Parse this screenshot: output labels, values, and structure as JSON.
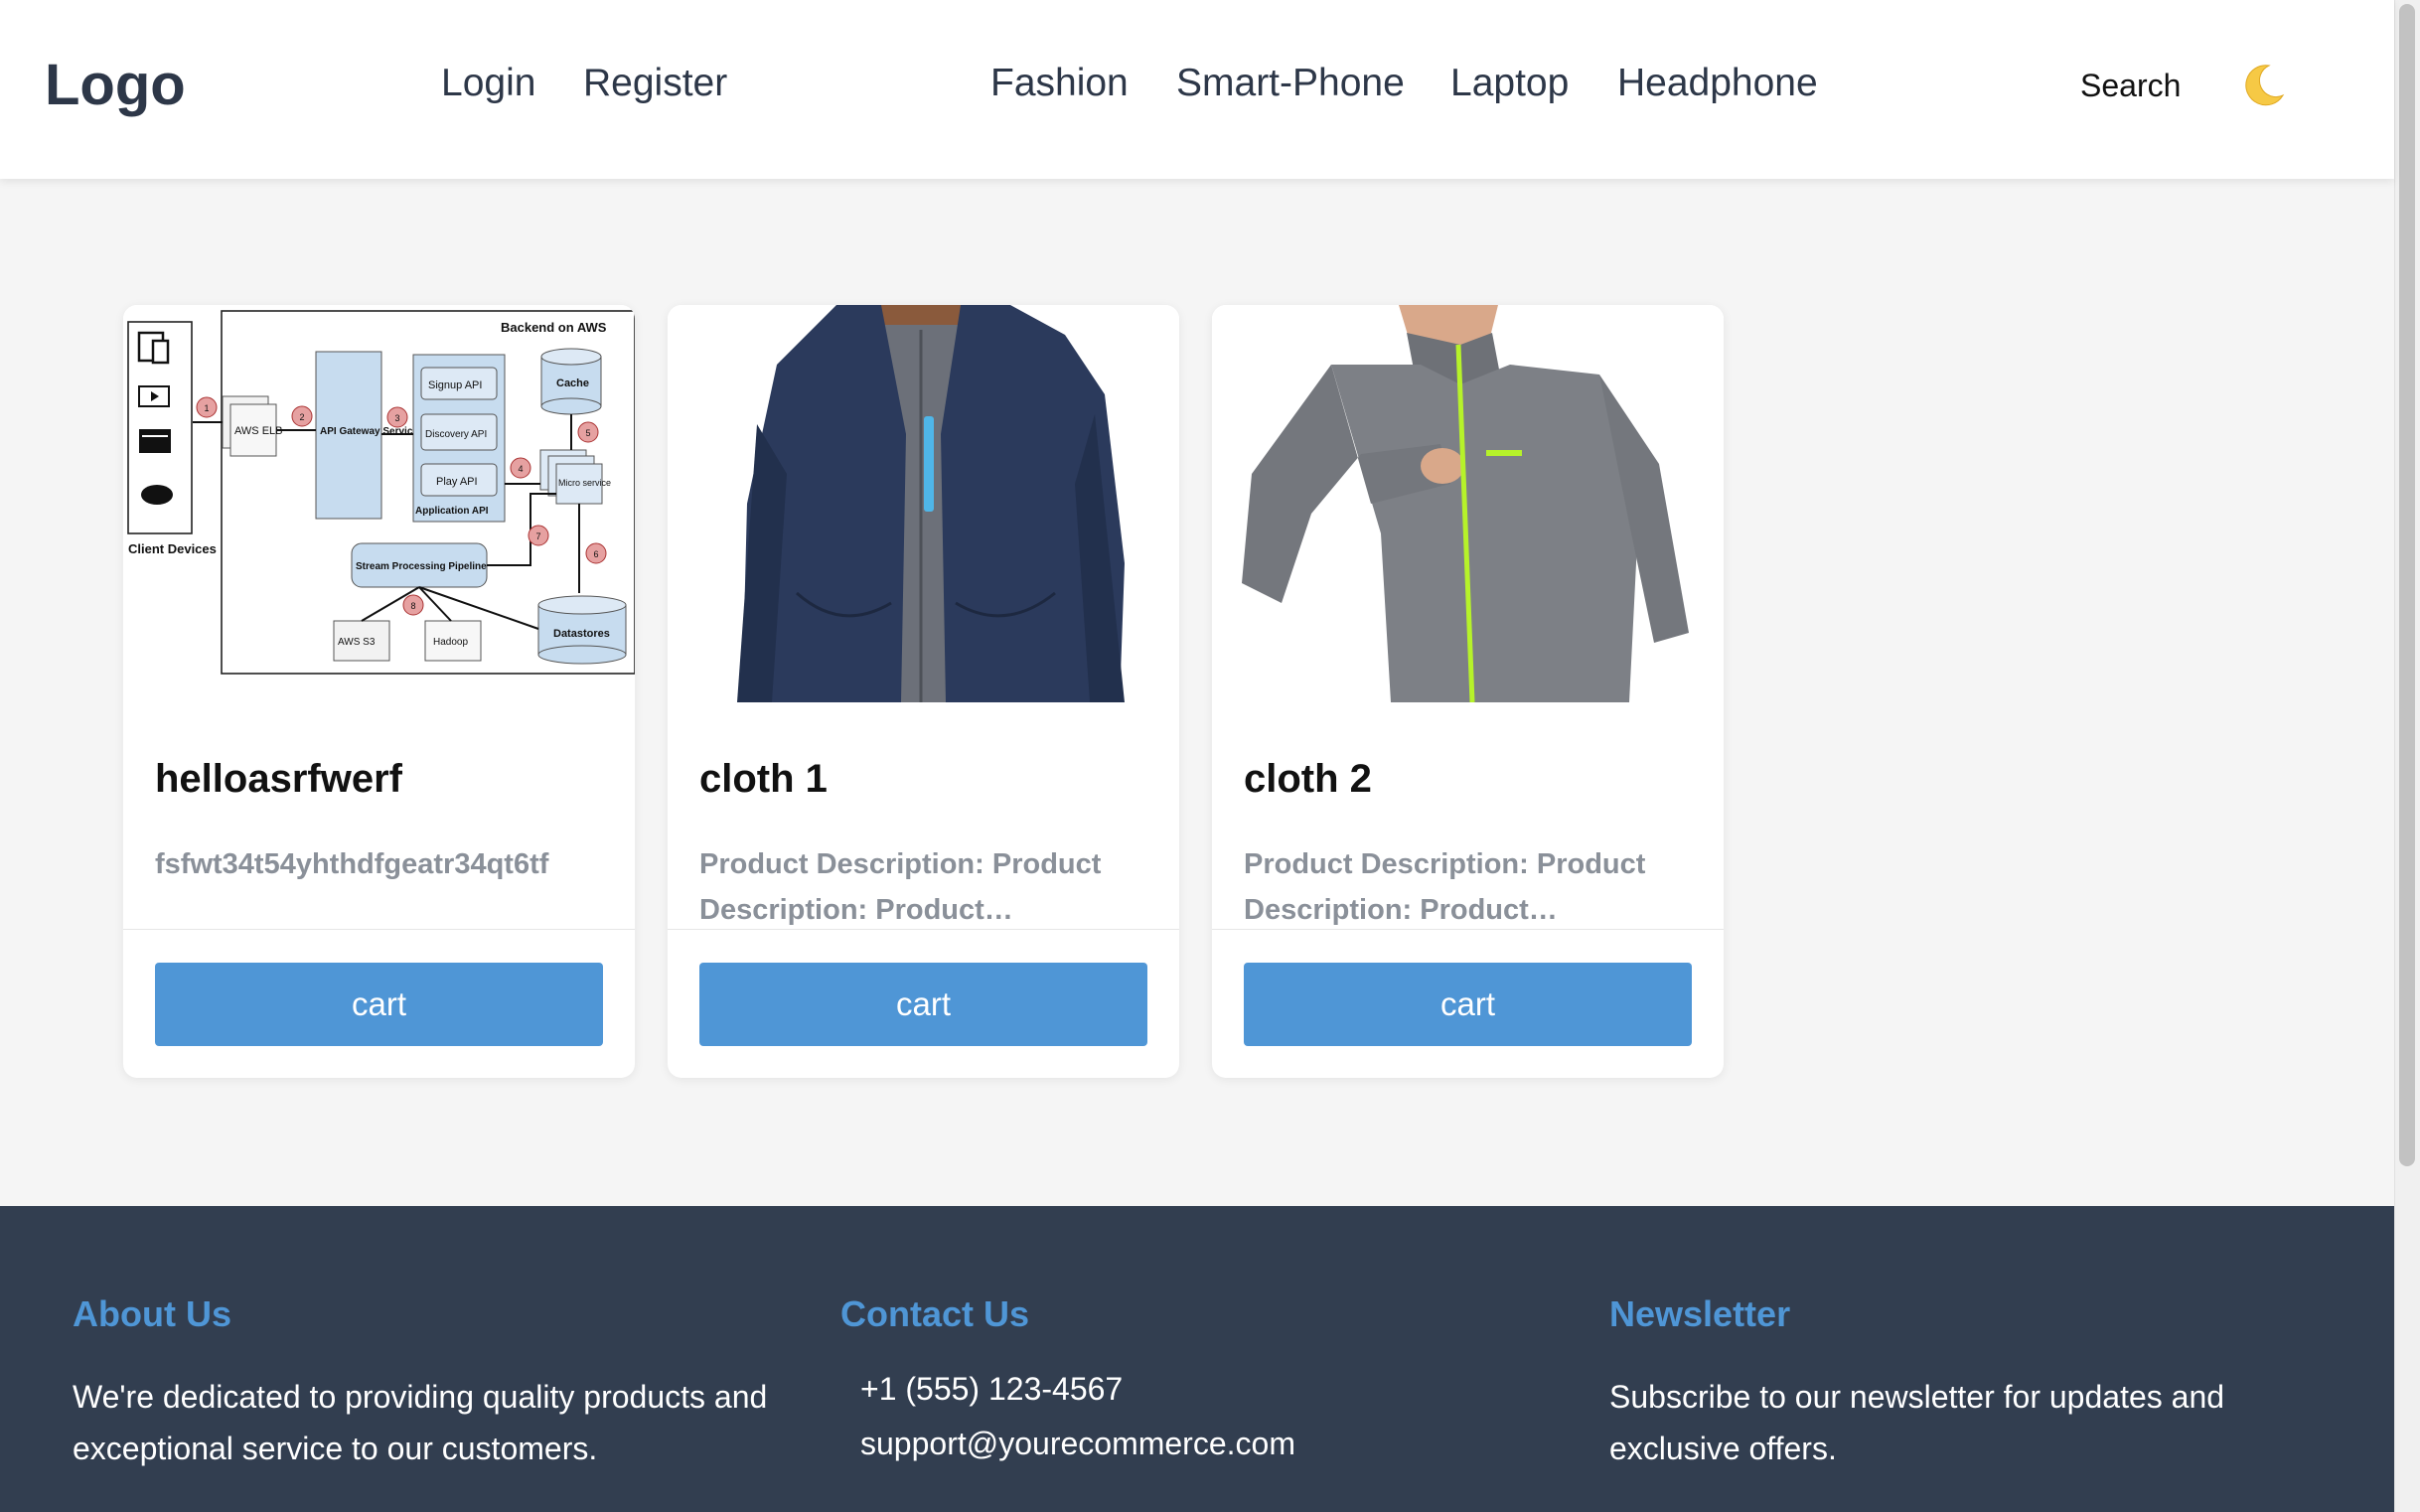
{
  "header": {
    "logo": "Logo",
    "auth_links": [
      "Login",
      "Register"
    ],
    "categories": [
      "Fashion",
      "Smart-Phone",
      "Laptop",
      "Headphone"
    ],
    "search_label": "Search",
    "theme_toggle_icon": "moon-icon"
  },
  "products": [
    {
      "title": "helloasrfwerf",
      "description": "fsfwt34t54yhthdfgeatr34qt6tf",
      "cart_label": "cart",
      "image": {
        "heading": "Backend on AWS",
        "client_label": "Client Devices",
        "aws_elb": "AWS ELB",
        "api_gateway": "API Gateway Service",
        "signup_api": "Signup API",
        "discovery_api": "Discovery API",
        "play_api": "Play API",
        "application_api": "Application API",
        "cache": "Cache",
        "micro_service": "Micro service",
        "stream_pipeline": "Stream Processing Pipeline",
        "aws_s3": "AWS S3",
        "hadoop": "Hadoop",
        "datastores": "Datastores",
        "step_numbers": [
          "1",
          "2",
          "3",
          "4",
          "5",
          "6",
          "7",
          "8"
        ]
      }
    },
    {
      "title": "cloth 1",
      "description": "Product Description: Product Description: Product…",
      "cart_label": "cart"
    },
    {
      "title": "cloth 2",
      "description": "Product Description: Product Description: Product…",
      "cart_label": "cart"
    }
  ],
  "footer": {
    "about": {
      "heading": "About Us",
      "text": "We're dedicated to providing quality products and exceptional service to our customers."
    },
    "contact": {
      "heading": "Contact Us",
      "phone": "+1 (555) 123-4567",
      "email": "support@yourecommerce.com"
    },
    "newsletter": {
      "heading": "Newsletter",
      "text": "Subscribe to our newsletter for updates and exclusive offers."
    }
  },
  "colors": {
    "accent": "#4f96d6",
    "footer_bg": "#323e50",
    "text_dark": "#2d3748",
    "muted": "#8a9099",
    "jacket_navy": "#2b3a5c",
    "jacket_grey": "#7d8086",
    "zip_neon": "#b6f22a"
  }
}
